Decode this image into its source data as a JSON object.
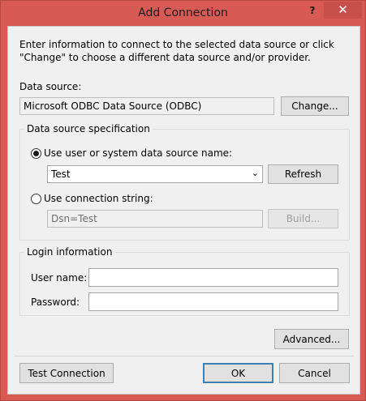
{
  "window": {
    "title": "Add Connection",
    "help": "?",
    "close": "✕"
  },
  "intro": "Enter information to connect to the selected data source or click \"Change\" to choose a different data source and/or provider.",
  "data_source": {
    "label": "Data source:",
    "value": "Microsoft ODBC Data Source (ODBC)",
    "change_button": "Change..."
  },
  "spec": {
    "legend": "Data source specification",
    "use_dsn_label": "Use user or system data source name:",
    "dsn_selected": "Test",
    "refresh_button": "Refresh",
    "use_conn_label": "Use connection string:",
    "conn_string": "Dsn=Test",
    "build_button": "Build..."
  },
  "login": {
    "legend": "Login information",
    "username_label": "User name:",
    "password_label": "Password:",
    "username_value": "",
    "password_value": ""
  },
  "buttons": {
    "advanced": "Advanced...",
    "test": "Test Connection",
    "ok": "OK",
    "cancel": "Cancel"
  }
}
